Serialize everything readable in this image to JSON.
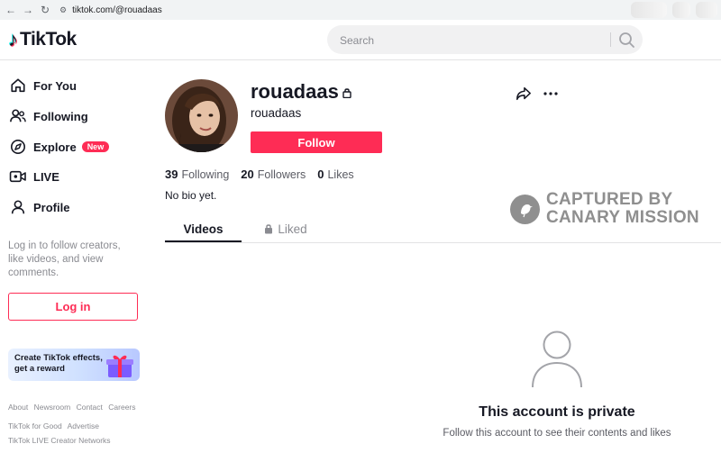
{
  "browser": {
    "url": "tiktok.com/@rouadaas",
    "back_icon": "arrow-left-icon",
    "forward_icon": "arrow-right-icon",
    "reload_icon": "reload-icon"
  },
  "header": {
    "logo_text": "TikTok",
    "search_placeholder": "Search"
  },
  "sidebar": {
    "items": [
      {
        "label": "For You",
        "icon": "home-icon"
      },
      {
        "label": "Following",
        "icon": "users-icon"
      },
      {
        "label": "Explore",
        "icon": "compass-icon",
        "badge": "New"
      },
      {
        "label": "LIVE",
        "icon": "live-icon"
      },
      {
        "label": "Profile",
        "icon": "person-icon"
      }
    ],
    "login_hint": "Log in to follow creators, like videos, and view comments.",
    "login_button": "Log in",
    "effects_banner": "Create TikTok effects, get a reward",
    "footer": {
      "row1": [
        "About",
        "Newsroom",
        "Contact",
        "Careers"
      ],
      "row2": [
        "TikTok for Good",
        "Advertise"
      ],
      "row3": [
        "TikTok LIVE Creator Networks"
      ]
    }
  },
  "profile": {
    "username": "rouadaas",
    "display_name": "rouadaas",
    "follow_button": "Follow",
    "stats": {
      "following_count": "39",
      "following_label": "Following",
      "followers_count": "20",
      "followers_label": "Followers",
      "likes_count": "0",
      "likes_label": "Likes"
    },
    "bio": "No bio yet."
  },
  "tabs": [
    {
      "label": "Videos",
      "active": true
    },
    {
      "label": "Liked",
      "active": false,
      "icon": "lock-icon"
    }
  ],
  "watermark": {
    "line1": "CAPTURED BY",
    "line2": "CANARY MISSION"
  },
  "private_state": {
    "title": "This account is private",
    "subtitle": "Follow this account to see their contents and likes"
  },
  "colors": {
    "brand": "#fe2c55",
    "text": "#161823",
    "muted": "#8a8b91"
  }
}
